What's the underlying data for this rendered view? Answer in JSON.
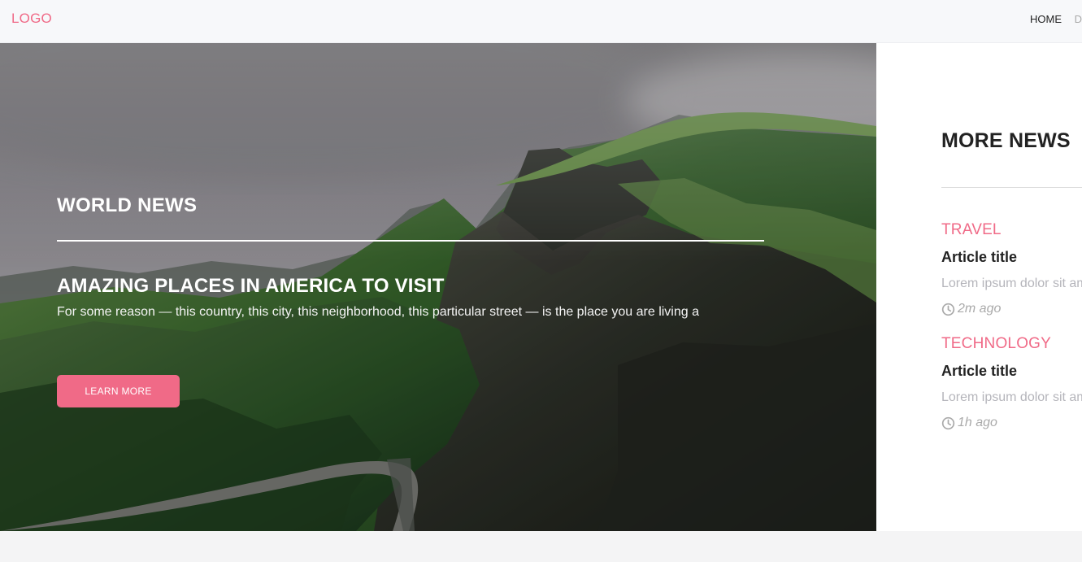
{
  "brand": {
    "logo_text": "LOGO",
    "accent_color": "#f06a87"
  },
  "nav": {
    "items": [
      {
        "label": "HOME"
      },
      {
        "label": "DI"
      }
    ]
  },
  "hero": {
    "category": "WORLD NEWS",
    "title": "AMAZING PLACES IN AMERICA TO VISIT",
    "excerpt": "For some reason — this country, this city, this neighborhood, this particular street — is the place you are living a",
    "button_label": "LEARN MORE",
    "image_alt": "green mountains"
  },
  "sidebar": {
    "title": "MORE NEWS",
    "items": [
      {
        "category": "TRAVEL",
        "title": "Article title",
        "excerpt": "Lorem ipsum dolor sit amet",
        "time": "2m ago",
        "icon": "clock-icon"
      },
      {
        "category": "TECHNOLOGY",
        "title": "Article title",
        "excerpt": "Lorem ipsum dolor sit amet",
        "time": "1h ago",
        "icon": "clock-icon"
      }
    ]
  }
}
